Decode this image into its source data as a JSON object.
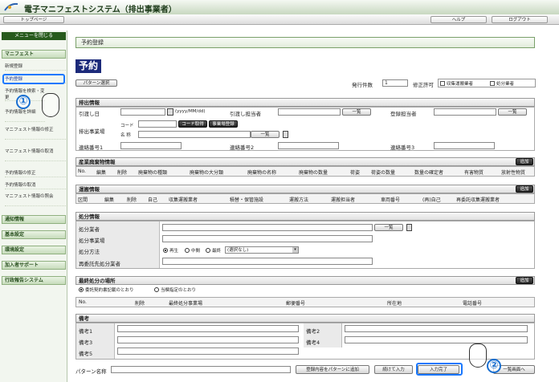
{
  "app": {
    "title": "電子マニフェストシステム（排出事業者）"
  },
  "nav": {
    "top": "トップページ",
    "help": "ヘルプ",
    "logout": "ログアウト"
  },
  "sidebar": {
    "close": "メニューを閉じる",
    "sections": [
      "マニフェスト",
      "通知情報",
      "基本設定",
      "環境設定",
      "加入者サポート",
      "行政報告システム"
    ],
    "items": [
      "新規登録",
      "予約登録",
      "予約情報を検索・変更",
      "予約情報を詳細",
      "マニフェスト情報の修正",
      "マニフェスト情報の取消",
      "予約情報の修正",
      "予約情報の取消",
      "マニフェスト情報の照会"
    ]
  },
  "page": {
    "heading": "予約登録",
    "title": "予約",
    "pattern_btn": "パターン選択",
    "issue_count_label": "発行件数",
    "issue_count": "1",
    "permit_label": "修正許可",
    "cb1": "収集運搬業者",
    "cb2": "処分業者"
  },
  "haishutsu": {
    "title": "排出情報",
    "date_label": "引渡し日",
    "date_hint": "(yyyy/MM/dd)",
    "person_label": "引渡し担当者",
    "ichiran": "一覧",
    "reg_label": "登録担当者",
    "site_label": "排出事業場",
    "code_label": "コード",
    "code_btn": "コード取得",
    "reg_btn": "事業場登録",
    "name_label": "名 称",
    "c1": "連絡番号1",
    "c2": "連絡番号2",
    "c3": "連絡番号3"
  },
  "sangyo": {
    "title": "産業廃棄物情報",
    "add": "追加",
    "cols": [
      "No.",
      "編集",
      "削除",
      "廃棄物の種類",
      "廃棄物の大分類",
      "廃棄物の名称",
      "廃棄物の数量",
      "荷姿",
      "荷姿の数量",
      "数量の確定者",
      "有害物質",
      "放射性物質"
    ]
  },
  "unpan": {
    "title": "運搬情報",
    "add": "追加",
    "cols": [
      "区間",
      "編集",
      "削除",
      "自己",
      "収集運搬業者",
      "積替・保管施設",
      "運搬方法",
      "運搬担当者",
      "車両番号",
      "(再)自己",
      "再委託収集運搬業者"
    ]
  },
  "shobun": {
    "title": "処分情報",
    "r1": "処分業者",
    "r2": "処分事業場",
    "r3": "処分方法",
    "r4": "再委託先処分業者",
    "ichiran": "一覧",
    "m1": "再生",
    "m2": "中間",
    "m3": "最終",
    "sel": "(選択なし)"
  },
  "saishu": {
    "title": "最終処分の場所",
    "add": "追加",
    "opt1": "委託契約書記載のとおり",
    "opt2": "当欄指定のとおり",
    "cols": [
      "No.",
      "削除",
      "最終処分事業場",
      "郵便番号",
      "所在地",
      "電話番号"
    ]
  },
  "biko": {
    "title": "備考",
    "labels": [
      "備考1",
      "備考2",
      "備考3",
      "備考4",
      "備考5"
    ]
  },
  "footer": {
    "pattern_label": "パターン名称",
    "reg": "登録内容をパターンに追加",
    "cont": "続けて入力",
    "done": "入力完了",
    "back": "一覧画面へ"
  },
  "annot": {
    "c1": "①",
    "c2": "②"
  }
}
